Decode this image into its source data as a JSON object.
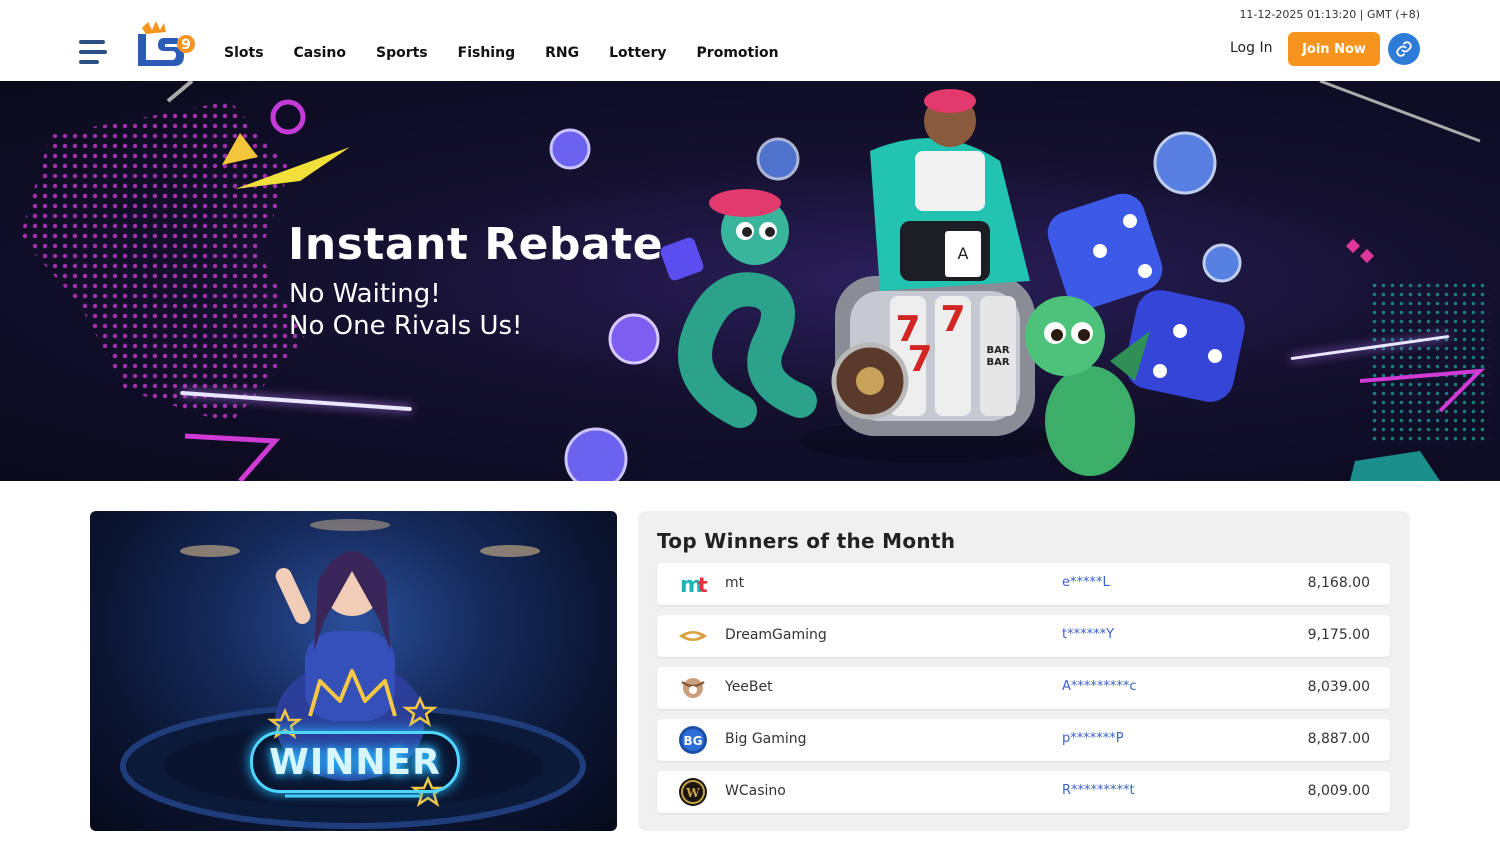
{
  "header": {
    "datetime": "11-12-2025 01:13:20 | GMT (+8)",
    "logo_text": "LS9",
    "nav": [
      "Slots",
      "Casino",
      "Sports",
      "Fishing",
      "RNG",
      "Lottery",
      "Promotion"
    ],
    "login_label": "Log In",
    "join_label": "Join Now"
  },
  "banner": {
    "title": "Instant Rebate",
    "subtitle_line1": "No Waiting!",
    "subtitle_line2": "No One Rivals Us!"
  },
  "winner_image": {
    "label": "WINNER"
  },
  "top_winners": {
    "title": "Top Winners of the Month",
    "rows": [
      {
        "provider": "mt",
        "icon": "mt-logo-icon",
        "user": "e*****L",
        "amount": "8,168.00"
      },
      {
        "provider": "DreamGaming",
        "icon": "dreamgaming-logo-icon",
        "user": "t******Y",
        "amount": "9,175.00"
      },
      {
        "provider": "YeeBet",
        "icon": "yeebet-logo-icon",
        "user": "A*********c",
        "amount": "8,039.00"
      },
      {
        "provider": "Big Gaming",
        "icon": "biggaming-logo-icon",
        "user": "p*******P",
        "amount": "8,887.00"
      },
      {
        "provider": "WCasino",
        "icon": "wcasino-logo-icon",
        "user": "R*********t",
        "amount": "8,009.00"
      }
    ]
  },
  "colors": {
    "accent": "#f7941d",
    "link_button": "#2f7bd8",
    "username": "#3a62c9"
  }
}
